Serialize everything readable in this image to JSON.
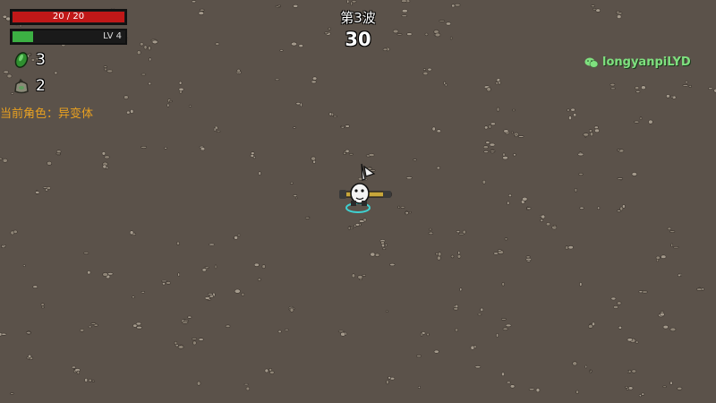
{
  "hud": {
    "hp": {
      "text": "20 / 20",
      "current": 20,
      "max": 20,
      "fill_color": "#c01818"
    },
    "xp": {
      "level_text": "LV 4",
      "progress": 0.18,
      "fill_color": "#3cb043"
    },
    "materials": {
      "icon": "green-material-icon",
      "count": "3"
    },
    "bags": {
      "icon": "material-bag-icon",
      "count": "2"
    },
    "character_line": "当前角色：异变体",
    "wave_label": "第3波",
    "timer": "30"
  },
  "watermark": {
    "icon": "wechat-icon",
    "text": "longyanpiLYD"
  },
  "player": {
    "icon": "mutant-character-sprite"
  },
  "colors": {
    "ground": "#5b524a",
    "character_text": "#e8a020",
    "watermark": "#7fe07f"
  }
}
